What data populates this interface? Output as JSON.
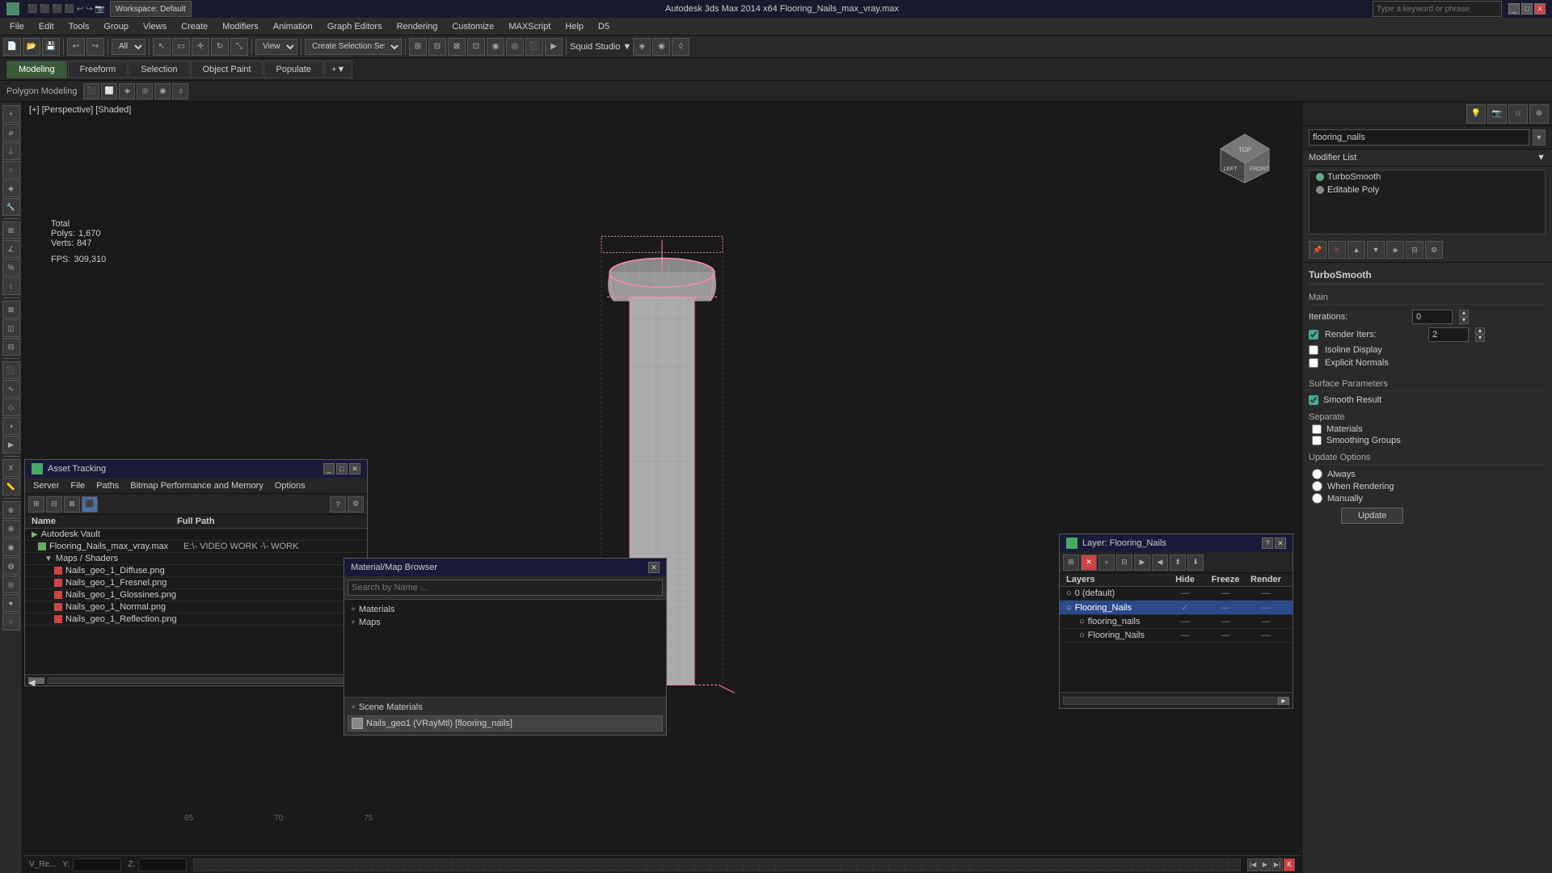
{
  "titlebar": {
    "app_icon": "3dsmax-icon",
    "title": "Autodesk 3ds Max 2014 x64  Flooring_Nails_max_vray.max",
    "search_placeholder": "Type a keyword or phrase",
    "minimize_label": "_",
    "maximize_label": "□",
    "close_label": "✕"
  },
  "menubar": {
    "items": [
      "File",
      "Edit",
      "Tools",
      "Group",
      "Views",
      "Create",
      "Modifiers",
      "Animation",
      "Graph Editors",
      "Rendering",
      "Customize",
      "MAXScript",
      "Help",
      "D5"
    ]
  },
  "toolbar": {
    "workspace_label": "Workspace: Default",
    "view_dropdown": "View",
    "create_selection": "Create Selection Set",
    "search_placeholder": "Type a keyword or phrase"
  },
  "mode_tabs": {
    "tabs": [
      "Modeling",
      "Freeform",
      "Selection",
      "Object Paint",
      "Populate"
    ],
    "active": "Modeling",
    "sub_label": "Polygon Modeling"
  },
  "viewport": {
    "label": "[+] [Perspective] [Shaded]",
    "stats": {
      "total_label": "Total",
      "polys_label": "Polys:",
      "polys_value": "1,670",
      "verts_label": "Verts:",
      "verts_value": "847",
      "fps_label": "FPS:",
      "fps_value": "309,310"
    },
    "grid_numbers": [
      "65",
      "70",
      "75"
    ],
    "y_label": "Y:",
    "z_label": "Z:"
  },
  "right_panel": {
    "object_name": "flooring_nails",
    "modifier_list_label": "Modifier List",
    "modifiers": [
      {
        "name": "TurboSmooth",
        "type": "turbo"
      },
      {
        "name": "Editable Poly",
        "type": "poly"
      }
    ],
    "turbosmooth": {
      "header": "TurboSmooth",
      "main_label": "Main",
      "iterations_label": "Iterations:",
      "iterations_value": "0",
      "render_iters_label": "Render Iters:",
      "render_iters_value": "2",
      "render_iters_checked": true,
      "isoline_display_label": "Isoline Display",
      "isoline_checked": false,
      "explicit_normals_label": "Explicit Normals",
      "explicit_normals_checked": false,
      "surface_params_label": "Surface Parameters",
      "smooth_result_label": "Smooth Result",
      "smooth_result_checked": true,
      "separate_label": "Separate",
      "materials_label": "Materials",
      "materials_checked": false,
      "smoothing_groups_label": "Smoothing Groups",
      "smoothing_groups_checked": false,
      "update_options_label": "Update Options",
      "always_label": "Always",
      "when_rendering_label": "When Rendering",
      "manually_label": "Manually",
      "update_btn_label": "Update"
    }
  },
  "asset_tracking": {
    "title": "Asset Tracking",
    "menu_items": [
      "Server",
      "File",
      "Paths",
      "Bitmap Performance and Memory",
      "Options"
    ],
    "col_name": "Name",
    "col_path": "Full Path",
    "items": [
      {
        "indent": 0,
        "type": "vault",
        "name": "Autodesk Vault",
        "path": ""
      },
      {
        "indent": 1,
        "type": "file",
        "name": "Flooring_Nails_max_vray.max",
        "path": "E:\\ VIDEO WORK -\\- WORK"
      },
      {
        "indent": 2,
        "type": "folder",
        "name": "Maps / Shaders",
        "path": ""
      },
      {
        "indent": 3,
        "type": "map",
        "name": "Nails_geo_1_Diffuse.png",
        "path": ""
      },
      {
        "indent": 3,
        "type": "map",
        "name": "Nails_geo_1_Fresnel.png",
        "path": ""
      },
      {
        "indent": 3,
        "type": "map",
        "name": "Nails_geo_1_Glossines.png",
        "path": ""
      },
      {
        "indent": 3,
        "type": "map",
        "name": "Nails_geo_1_Normal.png",
        "path": ""
      },
      {
        "indent": 3,
        "type": "map",
        "name": "Nails_geo_1_Reflection.png",
        "path": ""
      }
    ]
  },
  "material_browser": {
    "title": "Material/Map Browser",
    "search_placeholder": "Search by Name ...",
    "categories": [
      "+ Materials",
      "+ Maps",
      "+ Scene Materials"
    ],
    "scene_item": "Nails_geo1 (VRayMtl) [flooring_nails]"
  },
  "layer_window": {
    "title": "Layer: Flooring_Nails",
    "col_layers": "Layers",
    "col_hide": "Hide",
    "col_freeze": "Freeze",
    "col_render": "Render",
    "layers": [
      {
        "name": "0 (default)",
        "hide": false,
        "freeze": false,
        "render": true,
        "selected": false
      },
      {
        "name": "Flooring_Nails",
        "hide": true,
        "freeze": false,
        "render": true,
        "selected": true
      },
      {
        "name": "flooring_nails",
        "hide": false,
        "freeze": false,
        "render": true,
        "selected": false
      },
      {
        "name": "Flooring_Nails",
        "hide": false,
        "freeze": false,
        "render": true,
        "selected": false
      }
    ]
  },
  "colors": {
    "active_tab_bg": "#3a5a3a",
    "selected_layer_bg": "#2a5a8a",
    "accent_blue": "#4a6fa5",
    "mod_turbo_color": "#6a8866",
    "toolbar_bg": "#2a2a2a",
    "viewport_bg": "#1a1a1a",
    "panel_bg": "#2a2a2a"
  }
}
